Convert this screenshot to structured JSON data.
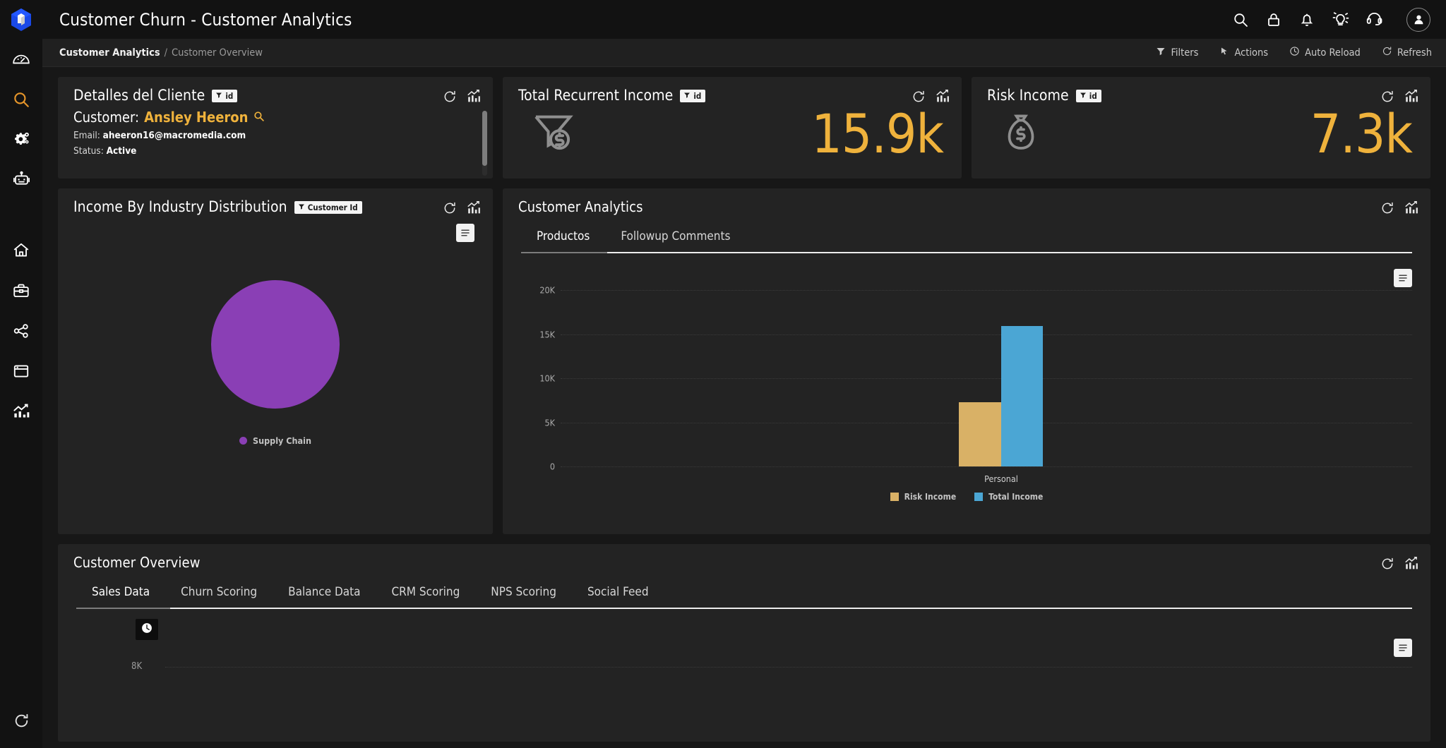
{
  "app": {
    "title": "Customer Churn - Customer Analytics",
    "logo_icon": "cube-logo-icon",
    "accent": "#efb23c",
    "background": "#171717",
    "card_background": "#232323"
  },
  "topbar": {
    "icons": [
      {
        "name": "search-icon",
        "label": "Search"
      },
      {
        "name": "lock-icon",
        "label": "Lock"
      },
      {
        "name": "bell-icon",
        "label": "Notifications"
      },
      {
        "name": "lightbulb-icon",
        "label": "Ideas"
      },
      {
        "name": "headset-icon",
        "label": "Support"
      }
    ],
    "avatar": "user-avatar-icon"
  },
  "sidebar": {
    "items": [
      {
        "name": "dashboard-icon",
        "label": "Dashboard",
        "active": false
      },
      {
        "name": "search-icon",
        "label": "Search",
        "active": true
      },
      {
        "name": "settings-gears-icon",
        "label": "Settings",
        "active": false
      },
      {
        "name": "robot-icon",
        "label": "Automation",
        "active": false
      },
      {
        "name": "home-icon",
        "label": "Home",
        "active": false
      },
      {
        "name": "briefcase-icon",
        "label": "Business",
        "active": false
      },
      {
        "name": "share-icon",
        "label": "Share",
        "active": false
      },
      {
        "name": "window-icon",
        "label": "Windows",
        "active": false
      },
      {
        "name": "analytics-icon",
        "label": "Analytics",
        "active": false
      }
    ],
    "bottom": {
      "name": "refresh-icon",
      "label": "Refresh"
    },
    "active_color": "#e5952a"
  },
  "breadcrumb": {
    "root": "Customer Analytics",
    "separator": "/",
    "leaf": "Customer Overview",
    "actions": [
      {
        "label": "Filters",
        "icon": "filter-icon"
      },
      {
        "label": "Actions",
        "icon": "cursor-icon"
      },
      {
        "label": "Auto Reload",
        "icon": "clock-icon"
      },
      {
        "label": "Refresh",
        "icon": "refresh-icon"
      }
    ]
  },
  "cards": {
    "details": {
      "title": "Detalles del Cliente",
      "chip": "id",
      "customer_label": "Customer:",
      "customer_name": "Ansley Heeron",
      "email_label": "Email:",
      "email_value": "aheeron16@macromedia.com",
      "status_label": "Status:",
      "status_value": "Active"
    },
    "total_recurrent_income": {
      "title": "Total Recurrent Income",
      "chip": "id",
      "value": "15.9k",
      "icon": "funnel-dollar-icon"
    },
    "risk_income": {
      "title": "Risk Income",
      "chip": "id",
      "value": "7.3k",
      "icon": "money-bag-icon"
    },
    "income_by_industry": {
      "title": "Income By Industry Distribution",
      "chip": "Customer Id"
    },
    "customer_analytics": {
      "title": "Customer Analytics",
      "tabs": [
        {
          "label": "Productos",
          "active": true
        },
        {
          "label": "Followup Comments",
          "active": false
        }
      ]
    },
    "customer_overview": {
      "title": "Customer Overview",
      "tabs": [
        {
          "label": "Sales Data",
          "active": true
        },
        {
          "label": "Churn Scoring",
          "active": false
        },
        {
          "label": "Balance Data",
          "active": false
        },
        {
          "label": "CRM Scoring",
          "active": false
        },
        {
          "label": "NPS Scoring",
          "active": false
        },
        {
          "label": "Social Feed",
          "active": false
        }
      ],
      "ytick": "8K",
      "clock_icon": "clock-icon"
    }
  },
  "tools": {
    "refresh": "refresh-icon",
    "chart": "chart-icon",
    "menu": "hamburger-menu-icon"
  },
  "chart_data": [
    {
      "type": "pie",
      "title": "Income By Industry Distribution",
      "categories": [
        "Supply Chain"
      ],
      "values": [
        100
      ],
      "colors": [
        "#8a3fb5"
      ],
      "legend": [
        "Supply Chain"
      ],
      "legend_position": "bottom"
    },
    {
      "type": "bar",
      "title": "Customer Analytics",
      "categories": [
        "Personal"
      ],
      "series": [
        {
          "name": "Risk Income",
          "values": [
            7300
          ],
          "color": "#d9b166"
        },
        {
          "name": "Total Income",
          "values": [
            15900
          ],
          "color": "#4ba6d4"
        }
      ],
      "yticks": [
        "0",
        "5K",
        "10K",
        "15K",
        "20K"
      ],
      "ytick_values": [
        0,
        5000,
        10000,
        15000,
        20000
      ],
      "ylim": [
        0,
        20000
      ],
      "xlabel": "",
      "ylabel": "",
      "grid": true,
      "legend_position": "bottom"
    },
    {
      "type": "bar",
      "title": "Customer Overview - Sales Data",
      "categories": [],
      "series": [],
      "yticks": [
        "8K"
      ],
      "ytick_values": [
        8000
      ],
      "grid": true
    }
  ]
}
